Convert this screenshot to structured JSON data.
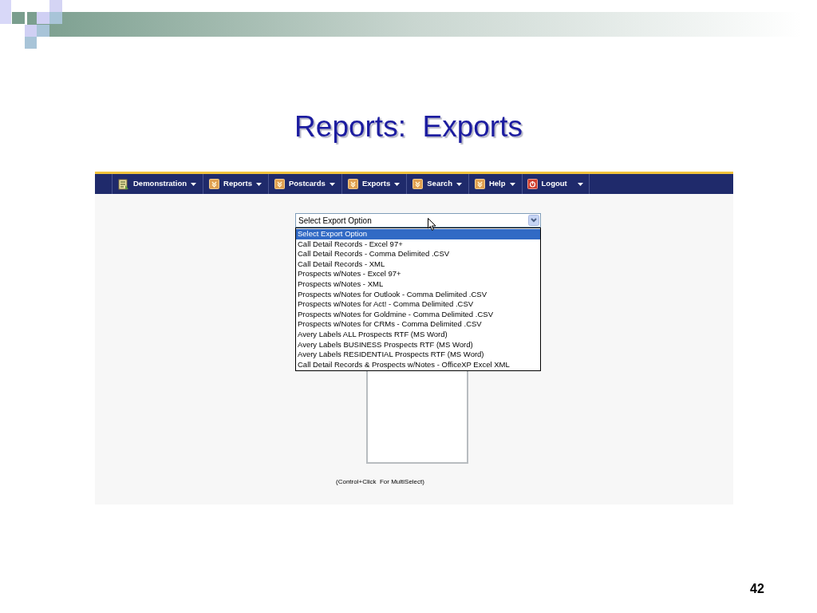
{
  "slide": {
    "title": "Reports:  Exports",
    "page_number": "42"
  },
  "nav": {
    "items": [
      {
        "label": "Demonstration",
        "kind": "demo"
      },
      {
        "label": "Reports",
        "kind": "menu"
      },
      {
        "label": "Postcards",
        "kind": "menu"
      },
      {
        "label": "Exports",
        "kind": "menu"
      },
      {
        "label": "Search",
        "kind": "menu"
      },
      {
        "label": "Help",
        "kind": "menu"
      },
      {
        "label": "Logout",
        "kind": "logout"
      }
    ]
  },
  "export_select": {
    "value": "Select Export Option",
    "options": [
      {
        "label": "Select Export Option",
        "selected": true
      },
      {
        "label": "Call Detail Records - Excel 97+",
        "selected": false
      },
      {
        "label": "Call Detail Records - Comma Delimited .CSV",
        "selected": false
      },
      {
        "label": "Call Detail Records - XML",
        "selected": false
      },
      {
        "label": "Prospects w/Notes - Excel 97+",
        "selected": false
      },
      {
        "label": "Prospects w/Notes - XML",
        "selected": false
      },
      {
        "label": "Prospects w/Notes for Outlook - Comma Delimited .CSV",
        "selected": false
      },
      {
        "label": "Prospects w/Notes for Act! - Comma Delimited .CSV",
        "selected": false
      },
      {
        "label": "Prospects w/Notes for Goldmine - Comma Delimited .CSV",
        "selected": false
      },
      {
        "label": "Prospects w/Notes for CRMs - Comma Delimited .CSV",
        "selected": false
      },
      {
        "label": "Avery Labels ALL Prospects RTF (MS Word)",
        "selected": false
      },
      {
        "label": "Avery Labels BUSINESS Prospects RTF (MS Word)",
        "selected": false
      },
      {
        "label": "Avery Labels RESIDENTIAL Prospects RTF (MS Word)",
        "selected": false
      },
      {
        "label": "Call Detail Records & Prospects w/Notes - OfficeXP Excel XML",
        "selected": false
      }
    ]
  },
  "multi_select_hint": "(Control+Click  For MultiSelect)"
}
